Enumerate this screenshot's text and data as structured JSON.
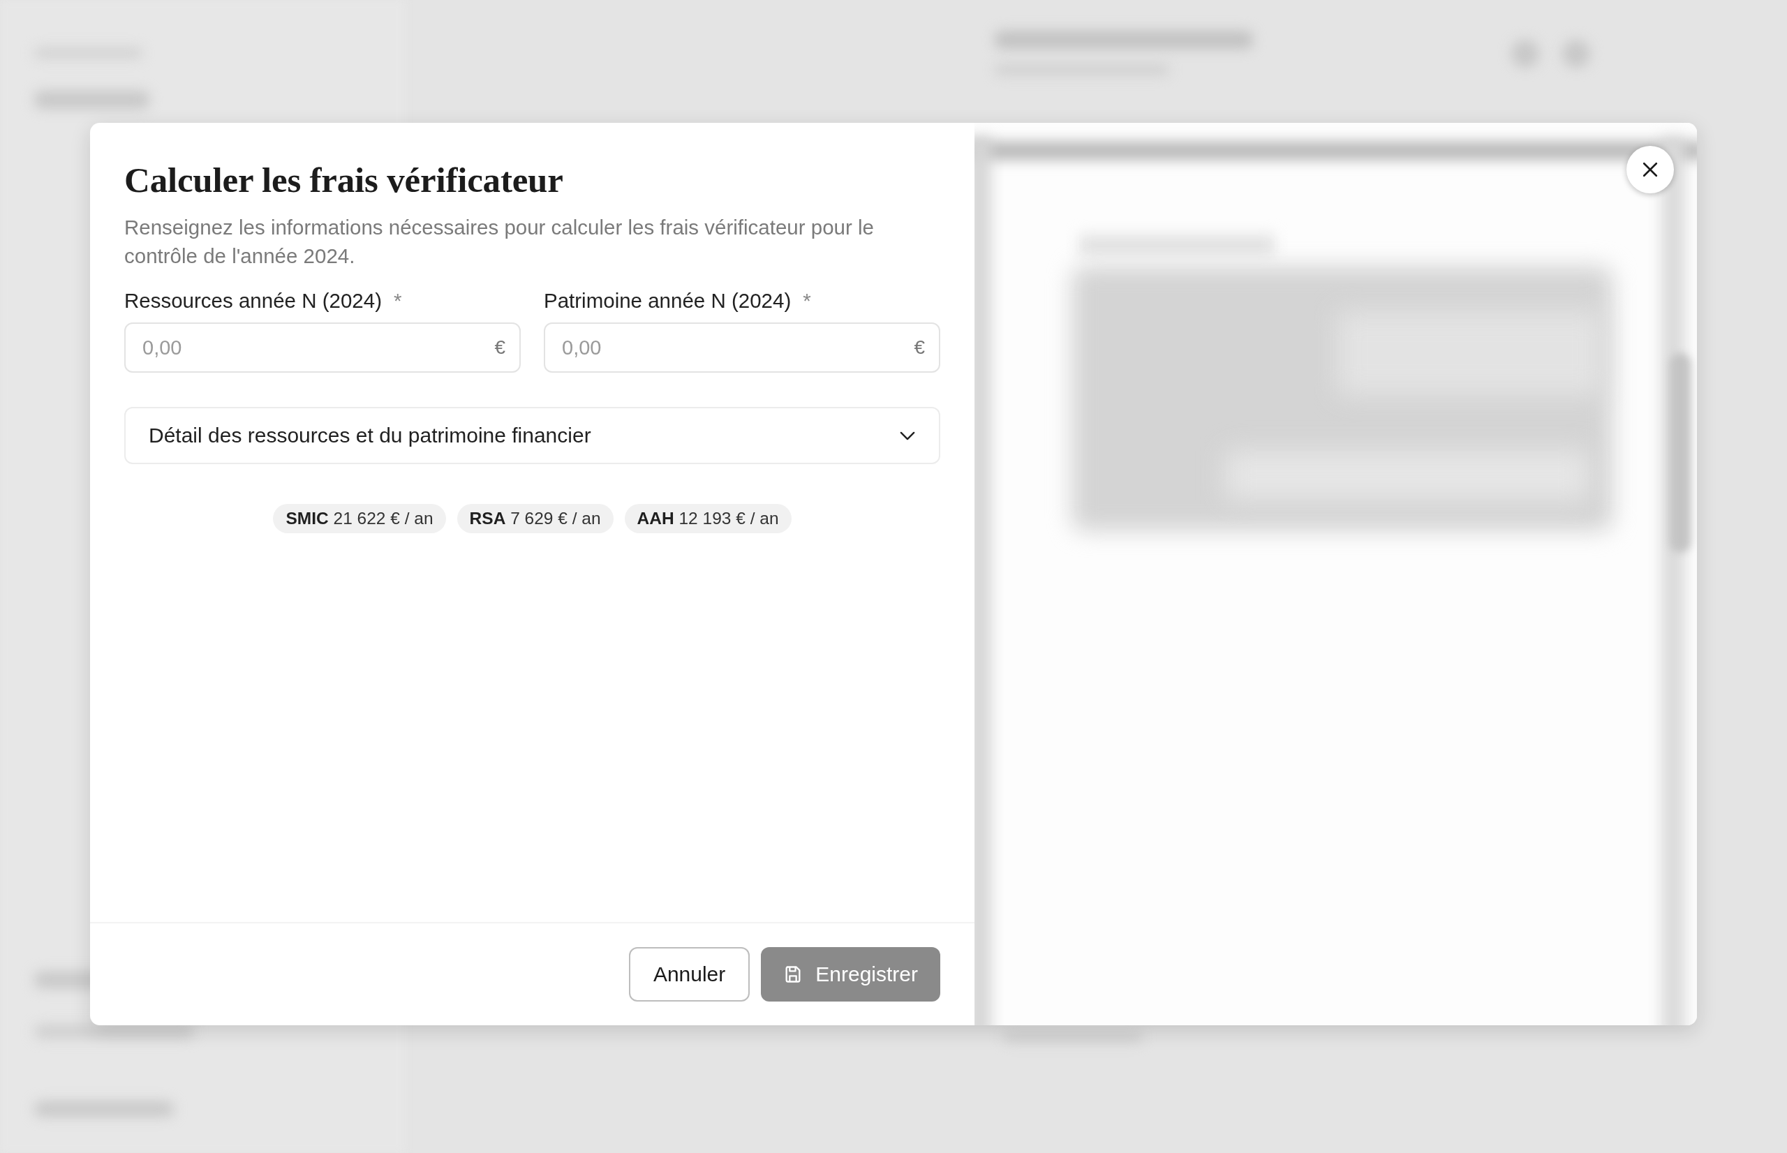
{
  "dialog": {
    "title": "Calculer les frais vérificateur",
    "description": "Renseignez les informations nécessaires pour calculer les frais vérificateur pour le contrôle de l'année 2024.",
    "fields": [
      {
        "label": "Ressources année N (2024)",
        "required_mark": "*",
        "placeholder": "0,00",
        "unit": "€"
      },
      {
        "label": "Patrimoine année N (2024)",
        "required_mark": "*",
        "placeholder": "0,00",
        "unit": "€"
      }
    ],
    "accordion": {
      "label": "Détail des ressources et du patrimoine financier",
      "expanded": false
    },
    "reference_rates": [
      "**SMIC** 21 622 € / an",
      "**RSA** 7 629 € / an",
      "**AAH** 12 193 € / an"
    ],
    "buttons": [
      {
        "kind": "cancel",
        "label": "Annuler",
        "disabled": false
      },
      {
        "kind": "save",
        "label": "Enregistrer",
        "disabled": true
      }
    ]
  }
}
